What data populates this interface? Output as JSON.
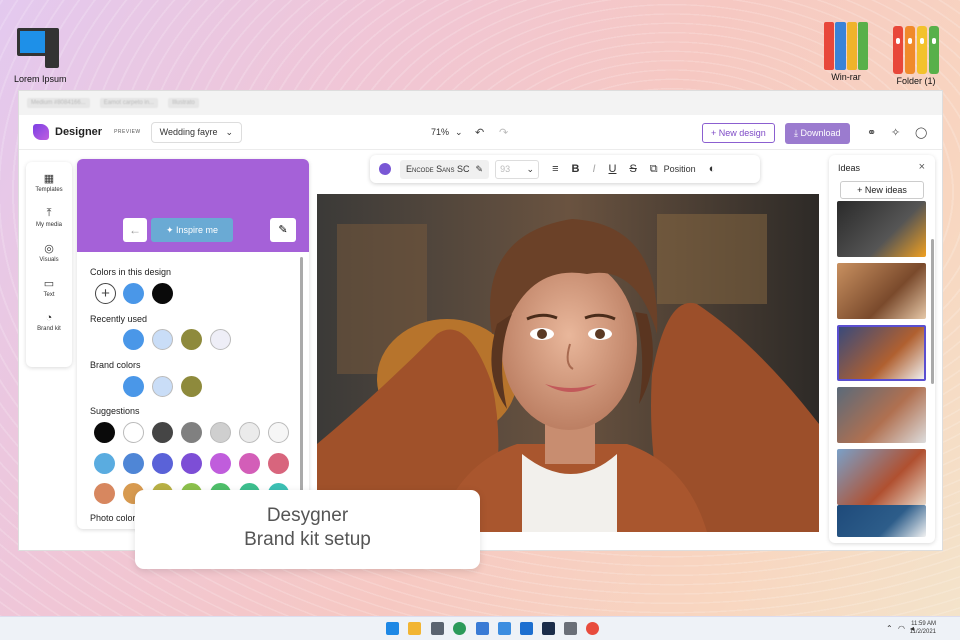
{
  "desktop": {
    "icons": [
      {
        "label": "Lorem Ipsum",
        "icon": "computer-icon"
      },
      {
        "label": "Win-rar",
        "icon": "winrar-icon"
      },
      {
        "label": "Folder (1)",
        "icon": "folder-binders-icon"
      }
    ]
  },
  "browser": {
    "tabs": [
      "Medium #8084166...",
      "Eamot carpeto in...",
      "Illustrato"
    ]
  },
  "app": {
    "brand": "Designer",
    "badge": "PREVIEW",
    "doc_name": "Wedding fayre",
    "zoom": "71%",
    "new_design": "+ New design",
    "download": "Download"
  },
  "rail": [
    {
      "label": "Templates",
      "icon": "templates-icon"
    },
    {
      "label": "My media",
      "icon": "upload-icon"
    },
    {
      "label": "Visuals",
      "icon": "visuals-icon"
    },
    {
      "label": "Text",
      "icon": "text-icon"
    },
    {
      "label": "Brand kit",
      "icon": "brand-kit-icon"
    }
  ],
  "panel": {
    "inspire": "Inspire me",
    "sections": {
      "colors_in_design": "Colors in this design",
      "recently_used": "Recently used",
      "brand_colors": "Brand colors",
      "suggestions": "Suggestions",
      "photo_colors": "Photo colors"
    },
    "colors": {
      "in_design": [
        "#4a97e8",
        "#0a0a0a"
      ],
      "recent": [
        "#4a97e8",
        "#c9ddf7",
        "#8e8a3c",
        "#eeeef7"
      ],
      "brand": [
        "#4a97e8",
        "#c9ddf7",
        "#8e8a3c"
      ],
      "suggest_row1": [
        "#0a0a0a",
        "#ffffff",
        "#454545",
        "#808080",
        "#cfcfcf",
        "#ebebeb",
        "#f6f6f6"
      ],
      "suggest_row2": [
        "#5aace0",
        "#4f86d6",
        "#5a62d8",
        "#7d4ed6",
        "#c05ddc",
        "#d35eb8",
        "#d8657d"
      ],
      "suggest_row3": [
        "#d7875f",
        "#d79a50",
        "#b8b045",
        "#8cc04c",
        "#4fbf6a",
        "#3dbf8e",
        "#3cc0b4"
      ]
    }
  },
  "toolbar": {
    "font": "Encode Sans SC",
    "size": "93",
    "position": "Position",
    "text_color": "#7957d5"
  },
  "ideas": {
    "title": "Ideas",
    "new_ideas": "+ New ideas"
  },
  "caption": {
    "line1": "Desygner",
    "line2": "Brand kit setup"
  },
  "taskbar": {
    "time": "11:59 AM",
    "date": "11/2/2021"
  }
}
